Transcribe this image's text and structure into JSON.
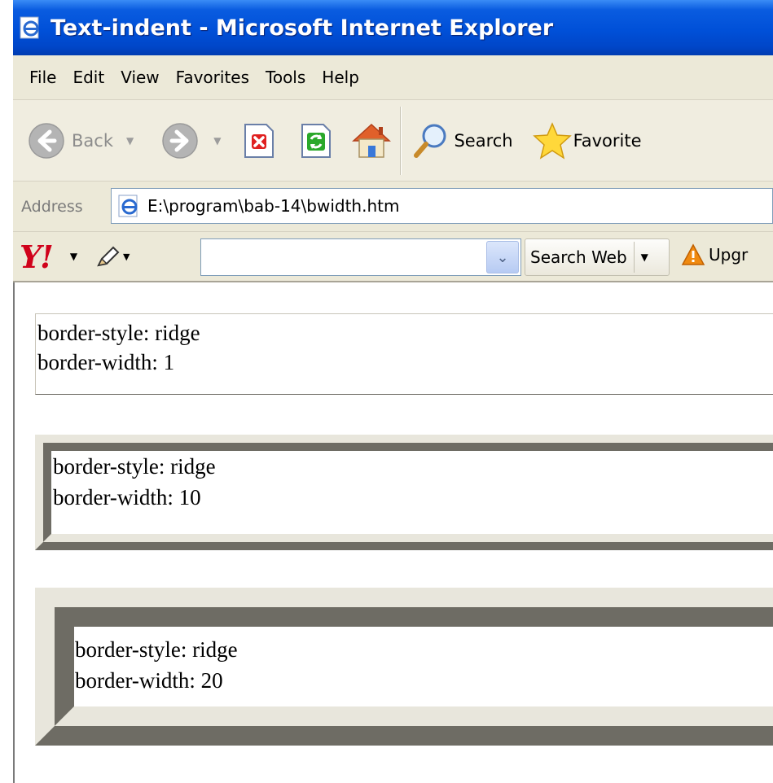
{
  "window": {
    "title": "Text-indent - Microsoft Internet Explorer"
  },
  "menu": {
    "items": [
      "File",
      "Edit",
      "View",
      "Favorites",
      "Tools",
      "Help"
    ]
  },
  "toolbar": {
    "back_label": "Back",
    "search_label": "Search",
    "favorites_label": "Favorite"
  },
  "address": {
    "label": "Address",
    "value": "E:\\program\\bab-14\\bwidth.htm"
  },
  "yahoo": {
    "logo": "Y!",
    "search_value": "",
    "search_web_label": "Search Web",
    "upgrade_label": "Upgr"
  },
  "content": {
    "boxes": [
      {
        "style_line": "border-style: ridge",
        "width_line": "border-width: 1"
      },
      {
        "style_line": "border-style: ridge",
        "width_line": "border-width: 10"
      },
      {
        "style_line": "border-style: ridge",
        "width_line": "border-width: 20"
      }
    ]
  },
  "colors": {
    "titlebar": "#0050d8",
    "chrome": "#ece9d8",
    "ridge_light": "#e8e6dc",
    "ridge_dark": "#6e6c64"
  }
}
